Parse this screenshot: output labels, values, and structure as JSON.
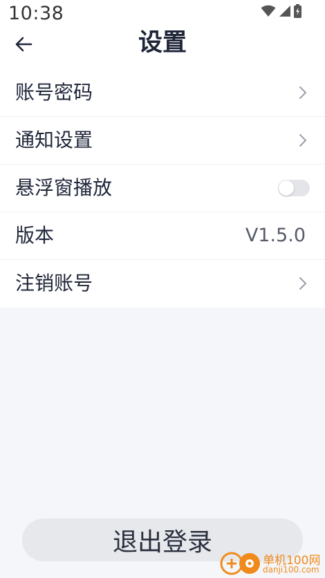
{
  "status_bar": {
    "time": "10:38",
    "icons": [
      "wifi-icon",
      "cell-signal-icon",
      "battery-icon"
    ]
  },
  "header": {
    "title": "设置",
    "back_icon": "arrow-left-icon"
  },
  "settings": {
    "items": [
      {
        "label": "账号密码",
        "type": "link"
      },
      {
        "label": "通知设置",
        "type": "link"
      },
      {
        "label": "悬浮窗播放",
        "type": "toggle",
        "enabled": false
      },
      {
        "label": "版本",
        "type": "value",
        "value": "V1.5.0"
      },
      {
        "label": "注销账号",
        "type": "link"
      }
    ]
  },
  "logout": {
    "label": "退出登录"
  },
  "watermark": {
    "name": "单机100网",
    "url": "danji100.com"
  },
  "colors": {
    "page_background": "#f5f6fa",
    "card_background": "#ffffff",
    "text_primary": "#1f2538",
    "toggle_off": "#e4e5e8",
    "logout_background": "#e7e8ec",
    "watermark": "#f08a1c"
  }
}
